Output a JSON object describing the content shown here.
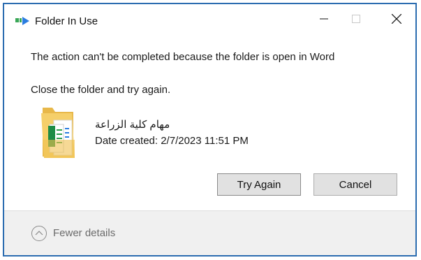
{
  "window": {
    "title": "Folder In Use",
    "icon": "folder-move-icon",
    "controls": {
      "minimize": "minimize-icon",
      "maximize": "maximize-icon",
      "close": "close-icon"
    }
  },
  "message": {
    "line1": "The action can't be completed because the folder is open in Word",
    "line2": "Close the folder and try again."
  },
  "file": {
    "icon": "folder-icon",
    "name": "مهام كلية الزراعة",
    "date_created": "Date created: 2/7/2023 11:51 PM"
  },
  "buttons": {
    "try_again": "Try Again",
    "cancel": "Cancel"
  },
  "footer": {
    "details_label": "Fewer details",
    "details_icon": "chevron-up-circle-icon"
  },
  "colors": {
    "border": "#2b6cb0",
    "button_bg": "#e1e1e1",
    "footer_bg": "#f0f0f0"
  }
}
